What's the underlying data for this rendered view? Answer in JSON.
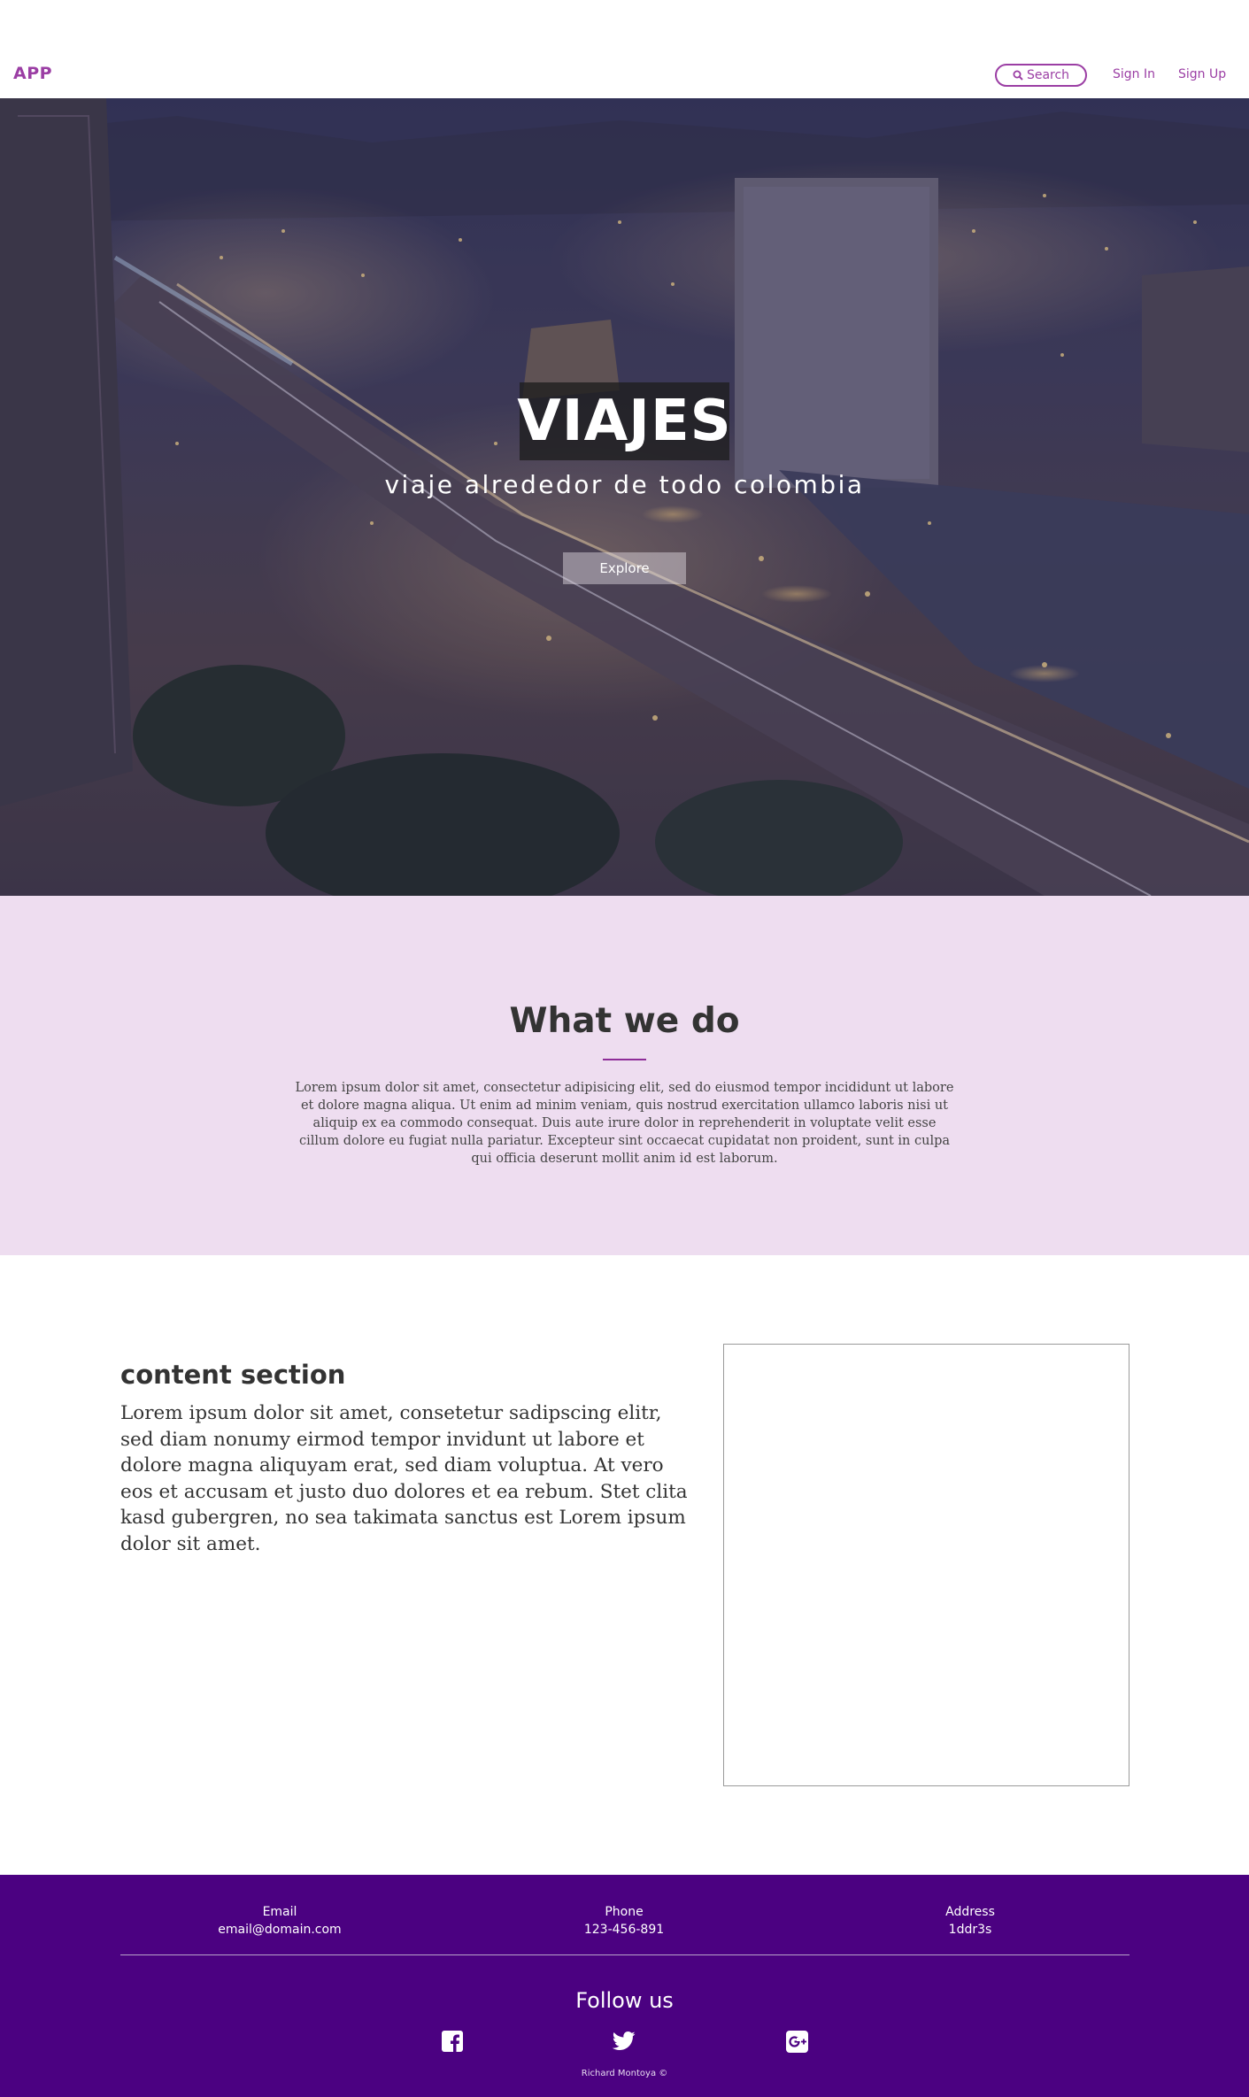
{
  "navbar": {
    "brand": "APP",
    "search_label": "Search",
    "sign_in": "Sign In",
    "sign_up": "Sign Up",
    "accent_color": "#9b3ea4"
  },
  "hero": {
    "title": "VIAJES",
    "subtitle": "viaje alrededor de todo colombia",
    "button": "Explore",
    "background": "night city aerial photo"
  },
  "what_we_do": {
    "title": "What we do",
    "text": "Lorem ipsum dolor sit amet, consectetur adipisicing elit, sed do eiusmod tempor incididunt ut labore et dolore magna aliqua. Ut enim ad minim veniam, quis nostrud exercitation ullamco laboris nisi ut aliquip ex ea commodo consequat. Duis aute irure dolor in reprehenderit in voluptate velit esse cillum dolore eu fugiat nulla pariatur. Excepteur sint occaecat cupidatat non proident, sunt in culpa qui officia deserunt mollit anim id est laborum.",
    "background_color": "#eeddf0"
  },
  "content": {
    "title": "content section",
    "text": "Lorem ipsum dolor sit amet, consetetur sadipscing elitr, sed diam nonumy eirmod tempor invidunt ut labore et dolore magna aliquyam erat, sed diam voluptua. At vero eos et accusam et justo duo dolores et ea rebum. Stet clita kasd gubergren, no sea takimata sanctus est Lorem ipsum dolor sit amet."
  },
  "footer": {
    "email_label": "Email",
    "email_value": "email@domain.com",
    "phone_label": "Phone",
    "phone_value": "123-456-891",
    "address_label": "Address",
    "address_value": "1ddr3s",
    "follow_title": "Follow us",
    "social_icons": [
      "facebook-icon",
      "twitter-icon",
      "google-plus-icon"
    ],
    "credit": "Richard Montoya ©",
    "background_color": "#4b0181"
  }
}
